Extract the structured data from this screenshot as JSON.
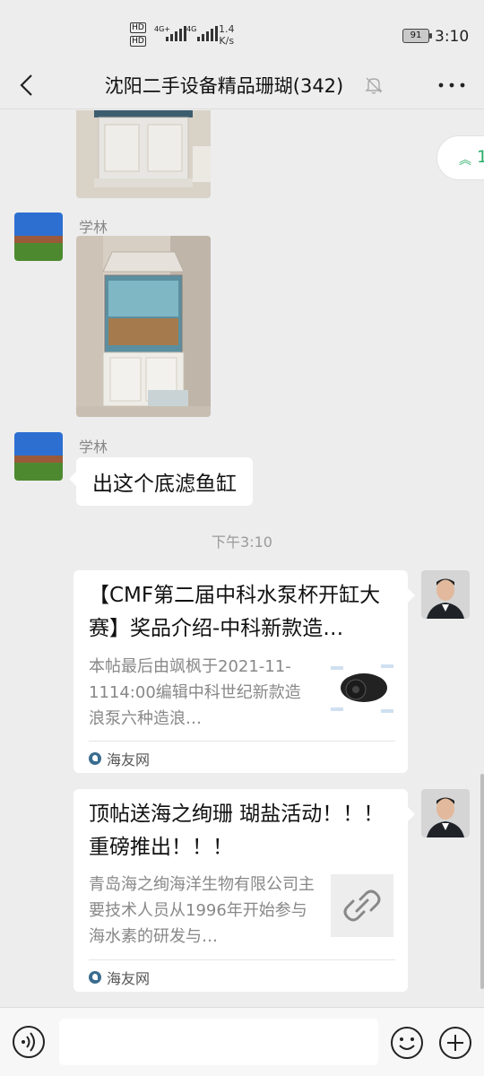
{
  "status_bar": {
    "hd1": "HD",
    "hd2": "HD",
    "net1": "4G+",
    "net2": "4G",
    "speed_value": "1.4",
    "speed_unit": "K/s",
    "battery": "91",
    "time": "3:10"
  },
  "header": {
    "title": "沈阳二手设备精品珊瑚(342)",
    "back_icon": "chevron-left-icon",
    "mute_icon": "bell-muted-icon",
    "more_icon": "more-dots-icon"
  },
  "new_messages_pill": {
    "count": "1"
  },
  "messages": [
    {
      "type": "image",
      "description_icon": "fish-tank-photo"
    },
    {
      "type": "image",
      "sender": "学林"
    },
    {
      "type": "text",
      "sender": "学林",
      "text": "出这个底滤鱼缸"
    }
  ],
  "time_divider": "下午3:10",
  "link_cards": [
    {
      "title": "【CMF第二届中科水泵杯开缸大赛】奖品介绍-中科新款造…",
      "description": "本帖最后由飒枫于2021-11-1114:00编辑中科世纪新款造浪泵六种造浪…",
      "source": "海友网",
      "thumb_icon": "wave-pump-thumbnail"
    },
    {
      "title": "顶帖送海之绚珊 瑚盐活动！！！ 重磅推出！！！",
      "description": "青岛海之绚海洋生物有限公司主要技术人员从1996年开始参与海水素的研发与…",
      "source": "海友网",
      "thumb_icon": "link-icon"
    }
  ],
  "input_bar": {
    "placeholder": "",
    "voice_icon": "voice-icon",
    "emoji_icon": "emoji-icon",
    "plus_icon": "plus-icon"
  }
}
